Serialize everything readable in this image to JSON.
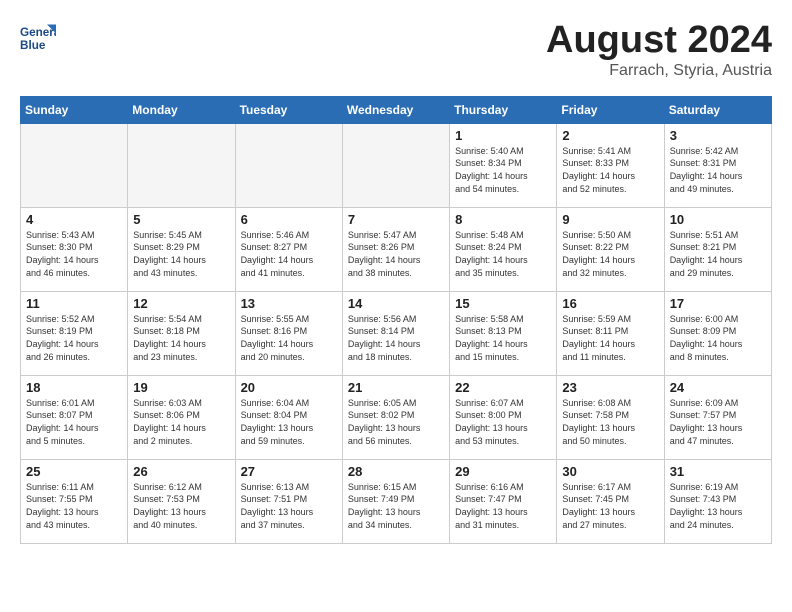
{
  "header": {
    "logo_line1": "General",
    "logo_line2": "Blue",
    "month_year": "August 2024",
    "location": "Farrach, Styria, Austria"
  },
  "days_of_week": [
    "Sunday",
    "Monday",
    "Tuesday",
    "Wednesday",
    "Thursday",
    "Friday",
    "Saturday"
  ],
  "weeks": [
    [
      {
        "day": "",
        "detail": ""
      },
      {
        "day": "",
        "detail": ""
      },
      {
        "day": "",
        "detail": ""
      },
      {
        "day": "",
        "detail": ""
      },
      {
        "day": "1",
        "detail": "Sunrise: 5:40 AM\nSunset: 8:34 PM\nDaylight: 14 hours\nand 54 minutes."
      },
      {
        "day": "2",
        "detail": "Sunrise: 5:41 AM\nSunset: 8:33 PM\nDaylight: 14 hours\nand 52 minutes."
      },
      {
        "day": "3",
        "detail": "Sunrise: 5:42 AM\nSunset: 8:31 PM\nDaylight: 14 hours\nand 49 minutes."
      }
    ],
    [
      {
        "day": "4",
        "detail": "Sunrise: 5:43 AM\nSunset: 8:30 PM\nDaylight: 14 hours\nand 46 minutes."
      },
      {
        "day": "5",
        "detail": "Sunrise: 5:45 AM\nSunset: 8:29 PM\nDaylight: 14 hours\nand 43 minutes."
      },
      {
        "day": "6",
        "detail": "Sunrise: 5:46 AM\nSunset: 8:27 PM\nDaylight: 14 hours\nand 41 minutes."
      },
      {
        "day": "7",
        "detail": "Sunrise: 5:47 AM\nSunset: 8:26 PM\nDaylight: 14 hours\nand 38 minutes."
      },
      {
        "day": "8",
        "detail": "Sunrise: 5:48 AM\nSunset: 8:24 PM\nDaylight: 14 hours\nand 35 minutes."
      },
      {
        "day": "9",
        "detail": "Sunrise: 5:50 AM\nSunset: 8:22 PM\nDaylight: 14 hours\nand 32 minutes."
      },
      {
        "day": "10",
        "detail": "Sunrise: 5:51 AM\nSunset: 8:21 PM\nDaylight: 14 hours\nand 29 minutes."
      }
    ],
    [
      {
        "day": "11",
        "detail": "Sunrise: 5:52 AM\nSunset: 8:19 PM\nDaylight: 14 hours\nand 26 minutes."
      },
      {
        "day": "12",
        "detail": "Sunrise: 5:54 AM\nSunset: 8:18 PM\nDaylight: 14 hours\nand 23 minutes."
      },
      {
        "day": "13",
        "detail": "Sunrise: 5:55 AM\nSunset: 8:16 PM\nDaylight: 14 hours\nand 20 minutes."
      },
      {
        "day": "14",
        "detail": "Sunrise: 5:56 AM\nSunset: 8:14 PM\nDaylight: 14 hours\nand 18 minutes."
      },
      {
        "day": "15",
        "detail": "Sunrise: 5:58 AM\nSunset: 8:13 PM\nDaylight: 14 hours\nand 15 minutes."
      },
      {
        "day": "16",
        "detail": "Sunrise: 5:59 AM\nSunset: 8:11 PM\nDaylight: 14 hours\nand 11 minutes."
      },
      {
        "day": "17",
        "detail": "Sunrise: 6:00 AM\nSunset: 8:09 PM\nDaylight: 14 hours\nand 8 minutes."
      }
    ],
    [
      {
        "day": "18",
        "detail": "Sunrise: 6:01 AM\nSunset: 8:07 PM\nDaylight: 14 hours\nand 5 minutes."
      },
      {
        "day": "19",
        "detail": "Sunrise: 6:03 AM\nSunset: 8:06 PM\nDaylight: 14 hours\nand 2 minutes."
      },
      {
        "day": "20",
        "detail": "Sunrise: 6:04 AM\nSunset: 8:04 PM\nDaylight: 13 hours\nand 59 minutes."
      },
      {
        "day": "21",
        "detail": "Sunrise: 6:05 AM\nSunset: 8:02 PM\nDaylight: 13 hours\nand 56 minutes."
      },
      {
        "day": "22",
        "detail": "Sunrise: 6:07 AM\nSunset: 8:00 PM\nDaylight: 13 hours\nand 53 minutes."
      },
      {
        "day": "23",
        "detail": "Sunrise: 6:08 AM\nSunset: 7:58 PM\nDaylight: 13 hours\nand 50 minutes."
      },
      {
        "day": "24",
        "detail": "Sunrise: 6:09 AM\nSunset: 7:57 PM\nDaylight: 13 hours\nand 47 minutes."
      }
    ],
    [
      {
        "day": "25",
        "detail": "Sunrise: 6:11 AM\nSunset: 7:55 PM\nDaylight: 13 hours\nand 43 minutes."
      },
      {
        "day": "26",
        "detail": "Sunrise: 6:12 AM\nSunset: 7:53 PM\nDaylight: 13 hours\nand 40 minutes."
      },
      {
        "day": "27",
        "detail": "Sunrise: 6:13 AM\nSunset: 7:51 PM\nDaylight: 13 hours\nand 37 minutes."
      },
      {
        "day": "28",
        "detail": "Sunrise: 6:15 AM\nSunset: 7:49 PM\nDaylight: 13 hours\nand 34 minutes."
      },
      {
        "day": "29",
        "detail": "Sunrise: 6:16 AM\nSunset: 7:47 PM\nDaylight: 13 hours\nand 31 minutes."
      },
      {
        "day": "30",
        "detail": "Sunrise: 6:17 AM\nSunset: 7:45 PM\nDaylight: 13 hours\nand 27 minutes."
      },
      {
        "day": "31",
        "detail": "Sunrise: 6:19 AM\nSunset: 7:43 PM\nDaylight: 13 hours\nand 24 minutes."
      }
    ]
  ]
}
